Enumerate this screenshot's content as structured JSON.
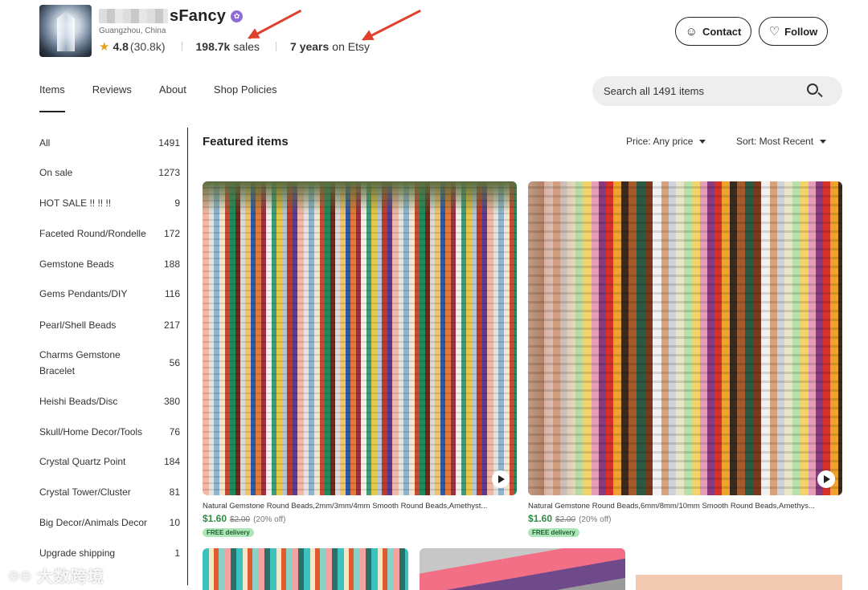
{
  "shop": {
    "name_visible": "sFancy",
    "location": "Guangzhou, China",
    "rating": "4.8",
    "rating_count": "(30.8k)",
    "sales_count": "198.7k",
    "sales_label": "sales",
    "years": "7 years",
    "years_suffix": "on Etsy",
    "contact_label": "Contact",
    "follow_label": "Follow"
  },
  "tabs": [
    {
      "label": "Items",
      "active": true
    },
    {
      "label": "Reviews",
      "active": false
    },
    {
      "label": "About",
      "active": false
    },
    {
      "label": "Shop Policies",
      "active": false
    }
  ],
  "search": {
    "placeholder": "Search all 1491 items"
  },
  "sidebar": {
    "items": [
      {
        "label": "All",
        "count": "1491"
      },
      {
        "label": "On sale",
        "count": "1273"
      },
      {
        "label": "HOT SALE !! !! !!",
        "count": "9"
      },
      {
        "label": "Faceted Round/Rondelle",
        "count": "172"
      },
      {
        "label": "Gemstone Beads",
        "count": "188"
      },
      {
        "label": "Gems Pendants/DIY",
        "count": "116"
      },
      {
        "label": "Pearl/Shell Beads",
        "count": "217"
      },
      {
        "label": "Charms Gemstone Bracelet",
        "count": "56"
      },
      {
        "label": "Heishi Beads/Disc",
        "count": "380"
      },
      {
        "label": "Skull/Home Decor/Tools",
        "count": "76"
      },
      {
        "label": "Crystal Quartz Point",
        "count": "184"
      },
      {
        "label": "Crystal Tower/Cluster",
        "count": "81"
      },
      {
        "label": "Big Decor/Animals Decor",
        "count": "10"
      },
      {
        "label": "Upgrade shipping",
        "count": "1"
      }
    ]
  },
  "main": {
    "title": "Featured items",
    "price_filter": "Price: Any price",
    "sort": "Sort: Most Recent",
    "listings": [
      {
        "title": "Natural Gemstone Round Beads,2mm/3mm/4mm Smooth Round Beads,Amethyst...",
        "price": "$1.60",
        "original_price": "$2.00",
        "discount": "(20% off)",
        "badge": "FREE delivery"
      },
      {
        "title": "Natural Gemstone Round Beads,6mm/8mm/10mm Smooth Round Beads,Amethys...",
        "price": "$1.60",
        "original_price": "$2.00",
        "discount": "(20% off)",
        "badge": "FREE delivery"
      }
    ]
  },
  "watermark": {
    "text": "大数跨境"
  },
  "colors": {
    "accent_green": "#2f8a45",
    "star": "#e5a31b",
    "annotation_arrow": "#e0412e",
    "star_seller_badge": "#8f6bd6"
  },
  "icons": [
    "star-icon",
    "star-seller-badge-icon",
    "contact-message-icon",
    "heart-icon",
    "search-icon",
    "caret-down-icon",
    "play-icon"
  ]
}
